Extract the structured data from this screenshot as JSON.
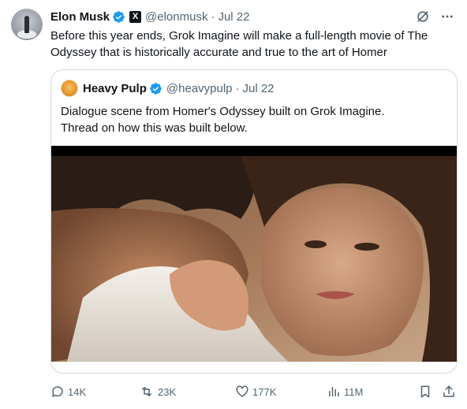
{
  "author": {
    "name": "Elon Musk",
    "handle": "@elonmusk",
    "date": "Jul 22",
    "avatar_icon": "rocket-launch-avatar",
    "verified_color": "#1d9bf0",
    "affiliate_badge": "X"
  },
  "tweet": {
    "text": "Before this year ends, Grok Imagine will make a full-length movie of The Odyssey that is historically accurate and true to the art of Homer"
  },
  "quote": {
    "name": "Heavy Pulp",
    "handle": "@heavypulp",
    "date": "Jul 22",
    "line1": "Dialogue scene from Homer's Odyssey built on Grok Imagine.",
    "line2": "Thread on how this was built below.",
    "media": "film-still-embrace"
  },
  "actions": {
    "replies": "14K",
    "reposts": "23K",
    "likes": "177K",
    "views": "11M"
  },
  "colors": {
    "text": "#0f1419",
    "muted": "#536471",
    "border": "#cfd9de",
    "accent": "#1d9bf0"
  }
}
